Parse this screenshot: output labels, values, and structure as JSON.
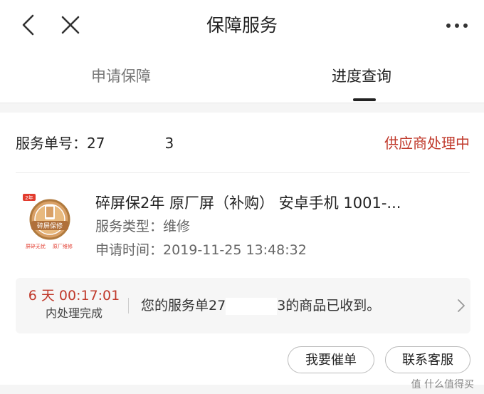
{
  "header": {
    "title": "保障服务"
  },
  "tabs": [
    {
      "label": "申请保障"
    },
    {
      "label": "进度查询"
    }
  ],
  "service": {
    "order_prefix": "服务单号：27",
    "order_suffix": "3",
    "status": "供应商处理中",
    "product_title": "碎屏保2年 原厂屏（补购） 安卓手机 1001-...",
    "type_label": "服务类型：",
    "type_value": "维修",
    "time_label": "申请时间：",
    "time_value": "2019-11-25 13:48:32"
  },
  "product_image": {
    "badge": "2年",
    "seal_text": "碎屏保修",
    "caption_left": "屏碎无忧",
    "caption_right": "原厂维修"
  },
  "notice": {
    "countdown": "6 天 00:17:01",
    "countdown_sub": "内处理完成",
    "text_prefix": "您的服务单27",
    "text_suffix": "3的商品已收到。"
  },
  "actions": {
    "urge_label": "我要催单",
    "contact_label": "联系客服"
  },
  "watermark": "值 什么值得买",
  "colors": {
    "status": "#c0392b",
    "accent": "#222222"
  }
}
